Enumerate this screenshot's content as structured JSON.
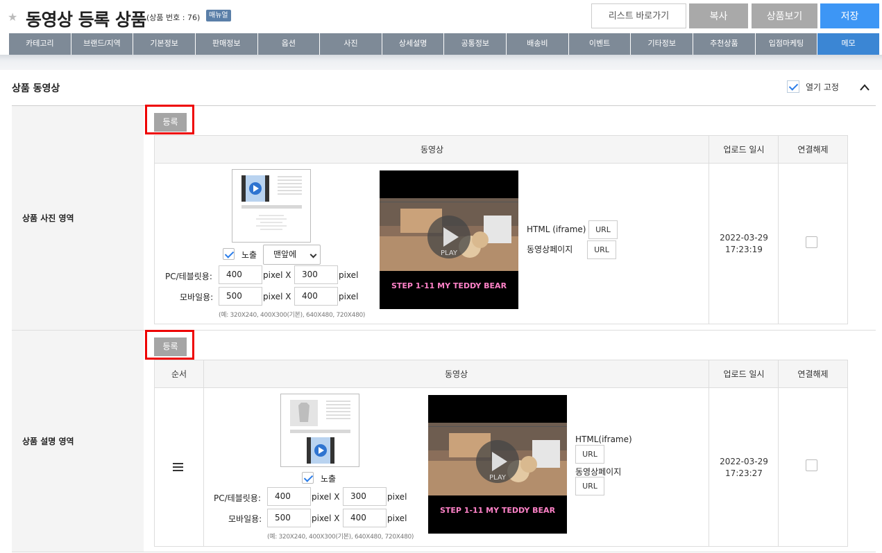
{
  "header": {
    "title": "동영상 등록 상품",
    "subtitle": "(상품 번호 : 76)",
    "manual_badge": "매뉴얼",
    "btn_list": "리스트 바로가기",
    "btn_copy": "복사",
    "btn_view": "상품보기",
    "btn_save": "저장"
  },
  "tabs": [
    "카테고리",
    "브랜드/지역",
    "기본정보",
    "판매정보",
    "옵션",
    "사진",
    "상세설명",
    "공통정보",
    "배송비",
    "이벤트",
    "기타정보",
    "추천상품",
    "입점마케팅",
    "메모"
  ],
  "active_tab": "메모",
  "section": {
    "title": "상품 동영상",
    "fix_label": "열기 고정",
    "fix_checked": true
  },
  "photo_area": {
    "label": "상품 사진 영역",
    "register_btn": "등록",
    "col_video": "동영상",
    "col_date": "업로드 일시",
    "col_unlink": "연결해제",
    "show_label": "노출",
    "show_checked": true,
    "position_select": "맨앞에",
    "pc_label": "PC/테블릿용:",
    "pc_w": "400",
    "pc_h": "300",
    "mobile_label": "모바일용:",
    "mobile_w": "500",
    "mobile_h": "400",
    "unit": "pixel",
    "x": "pixel X",
    "hint": "(예: 320X240, 400X300(기본), 640X480, 720X480)",
    "html_label": "HTML (iframe)",
    "page_label": "동영상페이지",
    "url_btn": "URL",
    "upload_date": "2022-03-29",
    "upload_time": "17:23:19",
    "video_caption": "STEP 1-11 MY TEDDY BEAR",
    "video_play": "PLAY"
  },
  "desc_area": {
    "label": "상품 설명 영역",
    "register_btn": "등록",
    "col_order": "순서",
    "col_video": "동영상",
    "col_date": "업로드 일시",
    "col_unlink": "연결해제",
    "show_label": "노출",
    "show_checked": true,
    "pc_label": "PC/테블릿용:",
    "pc_w": "400",
    "pc_h": "300",
    "mobile_label": "모바일용:",
    "mobile_w": "500",
    "mobile_h": "400",
    "unit": "pixel",
    "x": "pixel X",
    "hint": "(예: 320X240, 400X300(기본), 640X480, 720X480)",
    "html_label": "HTML(iframe)",
    "page_label": "동영상페이지",
    "url_btn": "URL",
    "upload_date": "2022-03-29",
    "upload_time": "17:23:27",
    "video_caption": "STEP 1-11 MY TEDDY BEAR",
    "video_play": "PLAY"
  }
}
